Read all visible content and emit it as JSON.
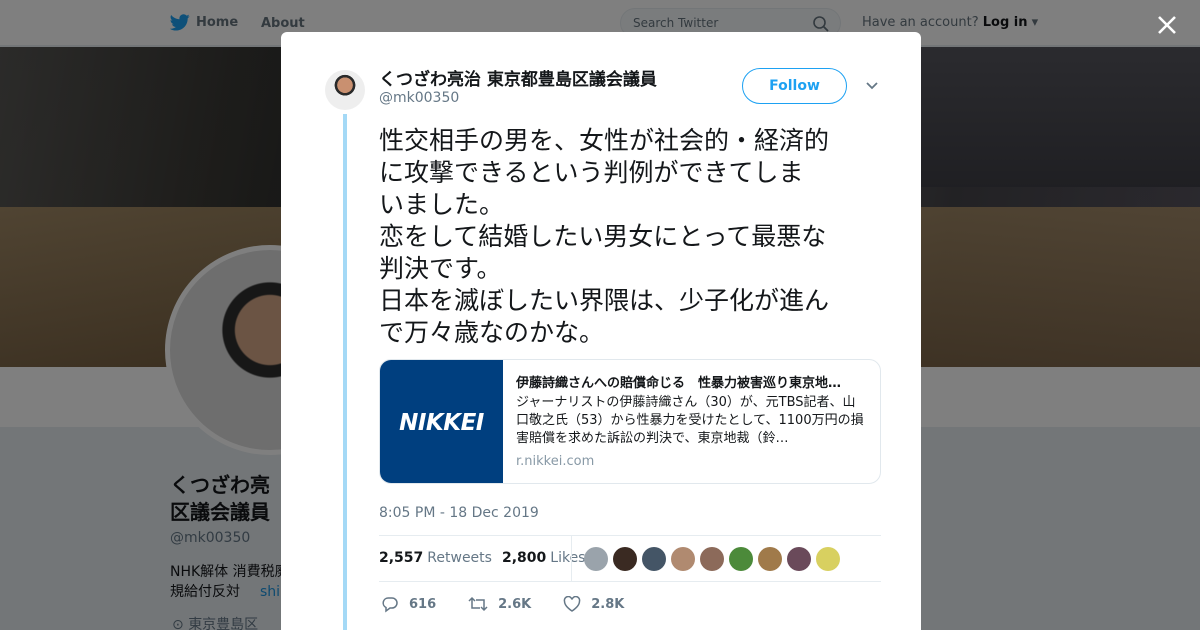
{
  "nav": {
    "home": "Home",
    "about": "About",
    "search_placeholder": "Search Twitter",
    "have_account": "Have an account?",
    "login": "Log in"
  },
  "profile": {
    "name": "くつざわ亮治 東京都豊島区議会議員",
    "name_visible": "くつざわ亮\n区議会議員",
    "handle": "@mk00350",
    "bio": "NHK解体 消費税廃\n規給付反対",
    "bio_link": "shik",
    "location": "東京豊島区"
  },
  "tweet": {
    "author_name": "くつざわ亮治 東京都豊島区議会議員",
    "author_handle": "@mk00350",
    "follow_label": "Follow",
    "text": "性交相手の男を、女性が社会的・経済的\nに攻撃できるという判例ができてしま\nいました。\n恋をして結婚したい男女にとって最悪な\n判決です。\n日本を滅ぼしたい界隈は、少子化が進ん\nで万々歳なのかな。",
    "card": {
      "image_text": "NIKKEI",
      "title": "伊藤詩織さんへの賠償命じる　性暴力被害巡り東京地…",
      "description": "ジャーナリストの伊藤詩織さん（30）が、元TBS記者、山口敬之氏（53）から性暴力を受けたとして、1100万円の損害賠償を求めた訴訟の判決で、東京地裁（鈴…",
      "domain": "r.nikkei.com"
    },
    "timestamp": "8:05 PM - 18 Dec 2019",
    "retweets_count": "2,557",
    "retweets_label": "Retweets",
    "likes_count": "2,800",
    "likes_label": "Likes",
    "reply_count": "616",
    "retweet_action_count": "2.6K",
    "like_action_count": "2.8K"
  },
  "colors": {
    "accent": "#1da1f2",
    "thread_line": "#a4d9f6",
    "nikkei_blue": "#003f7f"
  },
  "likers": [
    "#9aa3ab",
    "#3a2a22",
    "#445566",
    "#b08a70",
    "#8c6a5a",
    "#4c8a3a",
    "#a07a4a",
    "#6a4a5a",
    "#d8d060"
  ]
}
